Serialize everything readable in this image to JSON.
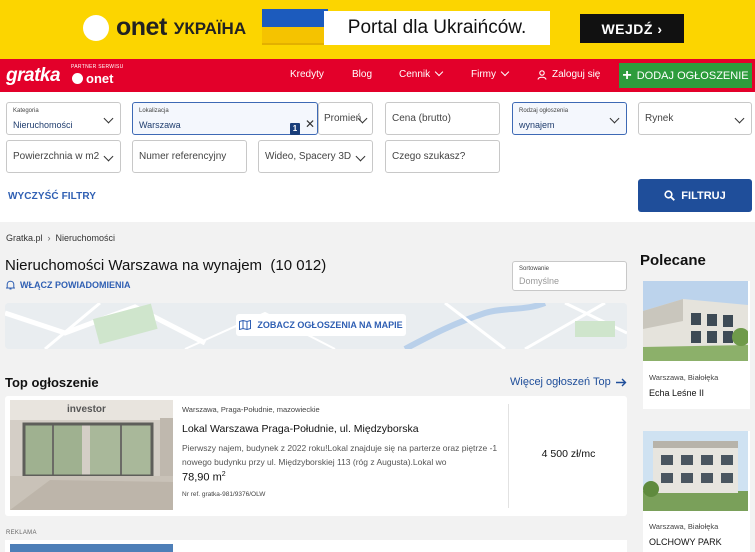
{
  "banner": {
    "brand": "onet",
    "brand_suffix": "УКРАЇНА",
    "portal_text": "Portal dla Ukraińców.",
    "cta_label": "WEJDŹ ›"
  },
  "nav": {
    "logo": "gratka",
    "partner": "PARTNER SERWISU",
    "partner_brand": "onet",
    "links": [
      "Kredyty",
      "Blog",
      "Cennik",
      "Firmy"
    ],
    "login": "Zaloguj się",
    "add_label": "DODAJ OGŁOSZENIE"
  },
  "filters": {
    "category": {
      "label": "Kategoria",
      "value": "Nieruchomości"
    },
    "location": {
      "label": "Lokalizacja",
      "value": "Warszawa",
      "count": "1"
    },
    "radius": "Promień",
    "price": "Cena (brutto)",
    "offer_type": {
      "label": "Rodzaj ogłoszenia",
      "value": "wynajem"
    },
    "market": "Rynek",
    "area": "Powierzchnia w m2",
    "ref_number": "Numer referencyjny",
    "video": "Wideo, Spacery 3D",
    "query": "Czego szukasz?",
    "clear": "WYCZYŚĆ FILTRY",
    "submit": "FILTRUJ"
  },
  "breadcrumb": [
    "Gratka.pl",
    "Nieruchomości"
  ],
  "heading": "Nieruchomości Warszawa na wynajem  (10 012)",
  "alerts": "WŁĄCZ POWIADOMIENIA",
  "sort": {
    "label": "Sortowanie",
    "value": "Domyślne"
  },
  "map_button": "ZOBACZ OGŁOSZENIA NA MAPIE",
  "top_section": {
    "title": "Top ogłoszenie",
    "more": "Więcej ogłoszeń Top"
  },
  "listing": {
    "image_label": "investor",
    "location": "Warszawa, Praga-Południe, mazowieckie",
    "title": "Lokal Warszawa Praga-Południe, ul. Międzyborska",
    "description": "Pierwszy najem, budynek z 2022 roku!Lokal znajduje się na parterze oraz piętrze -1 nowego budynku przy ul. Międzyborskiej 113 (róg z Augusta).Lokal wo",
    "area": "78,90 m",
    "area_sup": "2",
    "ref": "Nr ref. gratka-981/9376/OLW",
    "price": "4 500 zł/mc"
  },
  "reklama": "REKLAMA",
  "recommended": {
    "title": "Polecane",
    "items": [
      {
        "location": "Warszawa, Białołęka",
        "name": "Echa Leśne II"
      },
      {
        "location": "Warszawa, Białołęka",
        "name": "OLCHOWY PARK"
      }
    ]
  }
}
